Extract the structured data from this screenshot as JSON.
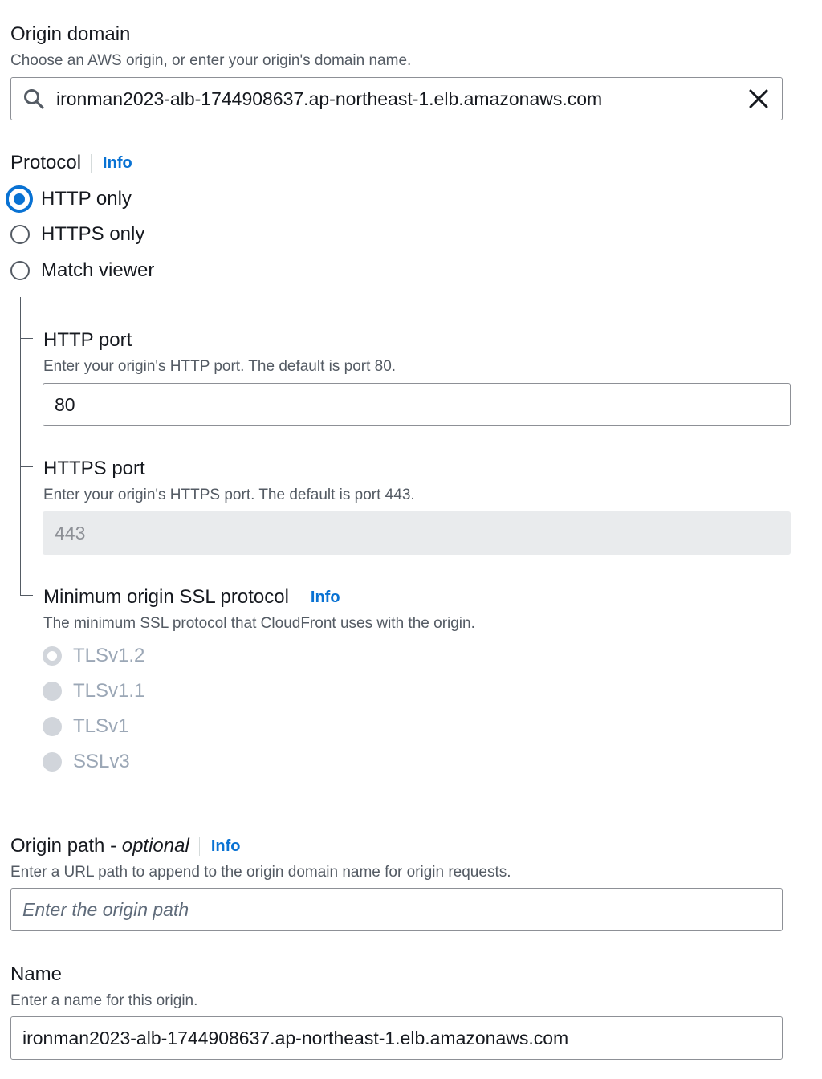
{
  "origin_domain": {
    "label": "Origin domain",
    "description": "Choose an AWS origin, or enter your origin's domain name.",
    "value": "ironman2023-alb-1744908637.ap-northeast-1.elb.amazonaws.com",
    "search_icon": "search-icon",
    "clear_icon": "close-icon"
  },
  "protocol": {
    "label": "Protocol",
    "info": "Info",
    "options": [
      {
        "label": "HTTP only",
        "selected": true
      },
      {
        "label": "HTTPS only",
        "selected": false
      },
      {
        "label": "Match viewer",
        "selected": false
      }
    ]
  },
  "http_port": {
    "label": "HTTP port",
    "description": "Enter your origin's HTTP port. The default is port 80.",
    "value": "80"
  },
  "https_port": {
    "label": "HTTPS port",
    "description": "Enter your origin's HTTPS port. The default is port 443.",
    "value": "443"
  },
  "min_ssl": {
    "label": "Minimum origin SSL protocol",
    "info": "Info",
    "description": "The minimum SSL protocol that CloudFront uses with the origin.",
    "options": [
      {
        "label": "TLSv1.2",
        "selected": true
      },
      {
        "label": "TLSv1.1",
        "selected": false
      },
      {
        "label": "TLSv1",
        "selected": false
      },
      {
        "label": "SSLv3",
        "selected": false
      }
    ]
  },
  "origin_path": {
    "label": "Origin path - ",
    "label_optional": "optional",
    "info": "Info",
    "description": "Enter a URL path to append to the origin domain name for origin requests.",
    "placeholder": "Enter the origin path"
  },
  "name": {
    "label": "Name",
    "description": "Enter a name for this origin.",
    "value": "ironman2023-alb-1744908637.ap-northeast-1.elb.amazonaws.com"
  }
}
